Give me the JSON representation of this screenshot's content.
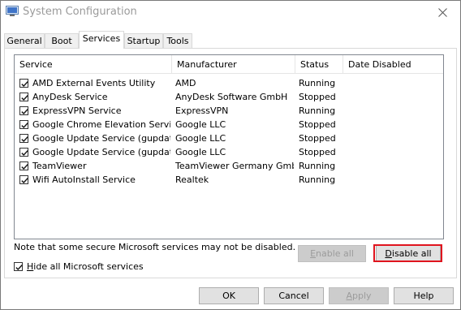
{
  "window": {
    "title": "System Configuration"
  },
  "tabs": [
    {
      "label": "General",
      "active": false
    },
    {
      "label": "Boot",
      "active": false
    },
    {
      "label": "Services",
      "active": true
    },
    {
      "label": "Startup",
      "active": false
    },
    {
      "label": "Tools",
      "active": false
    }
  ],
  "services": {
    "columns": [
      "Service",
      "Manufacturer",
      "Status",
      "Date Disabled"
    ],
    "rows": [
      {
        "checked": true,
        "name": "AMD External Events Utility",
        "manufacturer": "AMD",
        "status": "Running",
        "date_disabled": ""
      },
      {
        "checked": true,
        "name": "AnyDesk Service",
        "manufacturer": "AnyDesk Software GmbH",
        "status": "Stopped",
        "date_disabled": ""
      },
      {
        "checked": true,
        "name": "ExpressVPN Service",
        "manufacturer": "ExpressVPN",
        "status": "Running",
        "date_disabled": ""
      },
      {
        "checked": true,
        "name": "Google Chrome Elevation Servic...",
        "manufacturer": "Google LLC",
        "status": "Stopped",
        "date_disabled": ""
      },
      {
        "checked": true,
        "name": "Google Update Service (gupdate)",
        "manufacturer": "Google LLC",
        "status": "Stopped",
        "date_disabled": ""
      },
      {
        "checked": true,
        "name": "Google Update Service (gupdatem)",
        "manufacturer": "Google LLC",
        "status": "Stopped",
        "date_disabled": ""
      },
      {
        "checked": true,
        "name": "TeamViewer",
        "manufacturer": "TeamViewer Germany GmbH",
        "status": "Running",
        "date_disabled": ""
      },
      {
        "checked": true,
        "name": "Wifi AutoInstall Service",
        "manufacturer": "Realtek",
        "status": "Running",
        "date_disabled": ""
      }
    ]
  },
  "note": "Note that some secure Microsoft services may not be disabled.",
  "enable_all": {
    "pre": "",
    "accel": "E",
    "post": "nable all",
    "enabled": false
  },
  "disable_all": {
    "pre": "",
    "accel": "D",
    "post": "isable all",
    "enabled": true
  },
  "hide_ms": {
    "pre": "",
    "accel": "H",
    "post": "ide all Microsoft services",
    "checked": true
  },
  "footer": {
    "ok": "OK",
    "cancel": "Cancel",
    "apply": {
      "pre": "",
      "accel": "A",
      "post": "pply",
      "enabled": false
    },
    "help": "Help"
  },
  "colors": {
    "highlight": "#e0141e"
  },
  "icons": {
    "app": "msconfig-icon",
    "close": "close-icon",
    "check": "checkmark-icon"
  }
}
